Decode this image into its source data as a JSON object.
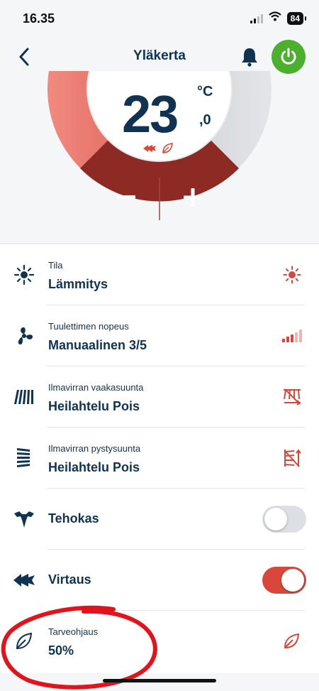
{
  "status_bar": {
    "time": "16.35",
    "battery": "84"
  },
  "header": {
    "title": "Yläkerta"
  },
  "dial": {
    "temperature": "23",
    "unit": "°C",
    "decimal": ",0"
  },
  "colors": {
    "navy": "#0f3350",
    "red": "#d9473a",
    "green": "#4caf2e",
    "toggle_off": "#dcdfe3"
  },
  "rows": [
    {
      "label": "Tila",
      "value": "Lämmitys"
    },
    {
      "label": "Tuulettimen nopeus",
      "value": "Manuaalinen 3/5"
    },
    {
      "label": "Ilmavirran vaakasuunta",
      "value": "Heilahtelu Pois"
    },
    {
      "label": "Ilmavirran pystysuunta",
      "value": "Heilahtelu Pois"
    },
    {
      "label": "Tehokas",
      "toggle": "off"
    },
    {
      "label": "Virtaus",
      "toggle": "on"
    },
    {
      "label": "Tarveohjaus",
      "value": "50%"
    }
  ]
}
